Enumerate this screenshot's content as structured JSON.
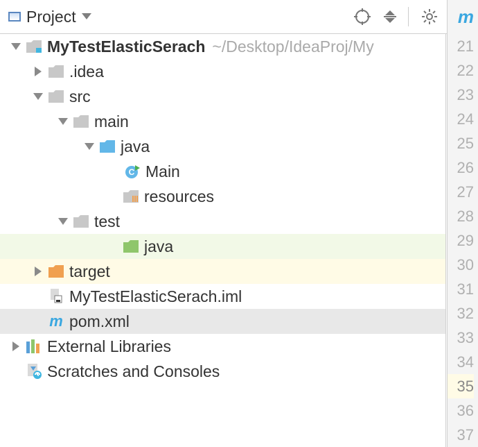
{
  "toolbar": {
    "label": "Project"
  },
  "tree": {
    "root": {
      "name": "MyTestElasticSerach",
      "path": "~/Desktop/IdeaProj/My"
    },
    "idea": ".idea",
    "src": "src",
    "main": "main",
    "java_main": "java",
    "main_class": "Main",
    "resources": "resources",
    "test": "test",
    "java_test": "java",
    "target": "target",
    "iml": "MyTestElasticSerach.iml",
    "pom": "pom.xml",
    "ext": "External Libraries",
    "scratch": "Scratches and Consoles"
  },
  "gutter": {
    "start": 21,
    "end": 37,
    "selected": 35
  }
}
